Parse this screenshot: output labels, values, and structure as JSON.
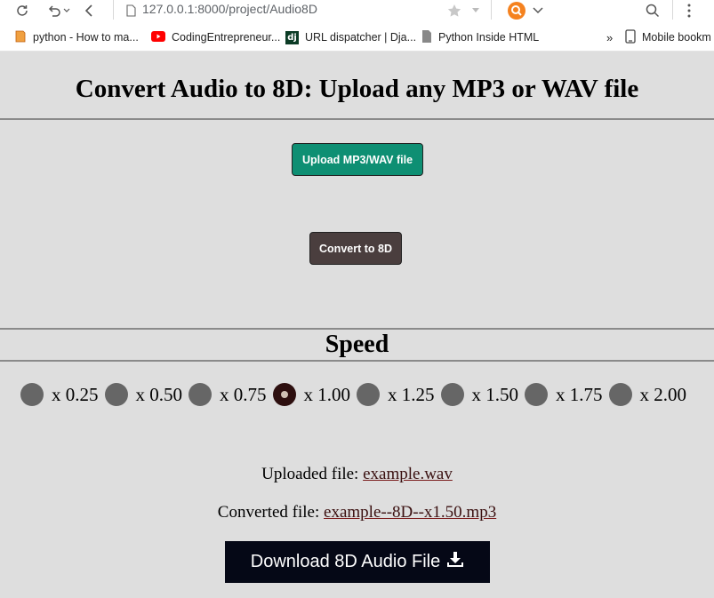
{
  "browser": {
    "url": "127.0.0.1:8000/project/Audio8D",
    "bookmarks": [
      {
        "label": "python - How to ma...",
        "icon": "bookmark-page-icon"
      },
      {
        "label": "CodingEntrepreneur...",
        "icon": "youtube-icon"
      },
      {
        "label": "URL dispatcher | Dja...",
        "icon": "django-icon",
        "icon_text": "dj"
      },
      {
        "label": "Python Inside HTML",
        "icon": "document-icon"
      },
      {
        "label": "Mobile bookm",
        "icon": "mobile-icon"
      }
    ],
    "overflow_label": "»"
  },
  "page": {
    "title": "Convert Audio to 8D: Upload any MP3 or WAV file",
    "upload_label": "Upload MP3/WAV file",
    "convert_label": "Convert to 8D",
    "speed_heading": "Speed",
    "speed_options": [
      {
        "label": "x 0.25",
        "selected": false
      },
      {
        "label": "x 0.50",
        "selected": false
      },
      {
        "label": "x 0.75",
        "selected": false
      },
      {
        "label": "x 1.00",
        "selected": true
      },
      {
        "label": "x 1.25",
        "selected": false
      },
      {
        "label": "x 1.50",
        "selected": false
      },
      {
        "label": "x 1.75",
        "selected": false
      },
      {
        "label": "x 2.00",
        "selected": false
      }
    ],
    "uploaded_prefix": "Uploaded file:",
    "uploaded_file": "example.wav",
    "converted_prefix": "Converted file:",
    "converted_file": "example--8D--x1.50.mp3",
    "download_label": "Download 8D Audio File"
  },
  "colors": {
    "upload_button": "#0e8f73",
    "convert_button": "#4a3e3e",
    "download_button": "#050816",
    "radio": "#666666",
    "radio_selected": "#2d0f0f"
  }
}
